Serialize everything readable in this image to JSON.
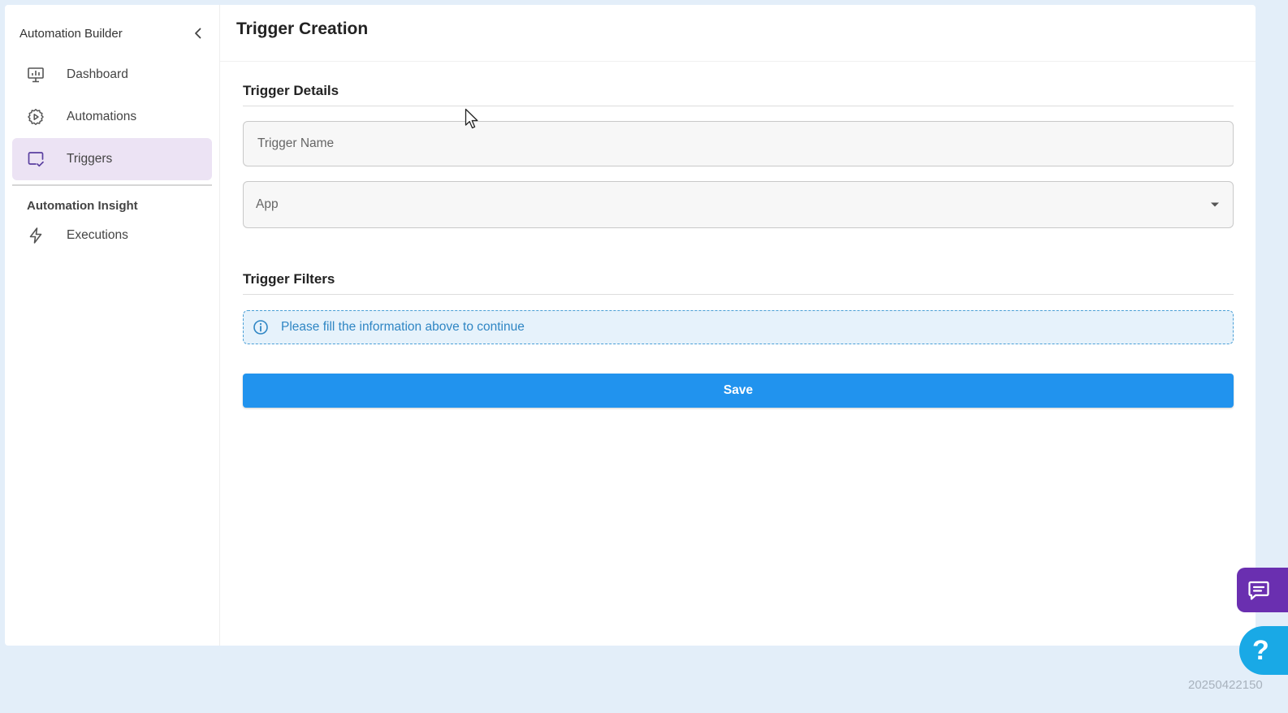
{
  "sidebar": {
    "title": "Automation Builder",
    "items": [
      {
        "label": "Dashboard",
        "icon": "dashboard-monitor-icon",
        "active": false
      },
      {
        "label": "Automations",
        "icon": "gear-play-icon",
        "active": false
      },
      {
        "label": "Triggers",
        "icon": "monitor-check-icon",
        "active": true
      }
    ],
    "insight_label": "Automation Insight",
    "insight_items": [
      {
        "label": "Executions",
        "icon": "lightning-icon"
      }
    ]
  },
  "main": {
    "title": "Trigger Creation",
    "details": {
      "heading": "Trigger Details",
      "trigger_name_placeholder": "Trigger Name",
      "app_label": "App"
    },
    "filters": {
      "heading": "Trigger Filters",
      "info": "Please fill the information above to continue"
    },
    "save_label": "Save"
  },
  "widgets": {
    "help_glyph": "?"
  },
  "footer": {
    "version": "20250422150"
  },
  "colors": {
    "accent": "#2193ee",
    "active_nav_bg": "#ece3f4",
    "chat_fab": "#6a2fb0",
    "help_fab": "#19a9e6",
    "info_text": "#2f86c4"
  }
}
